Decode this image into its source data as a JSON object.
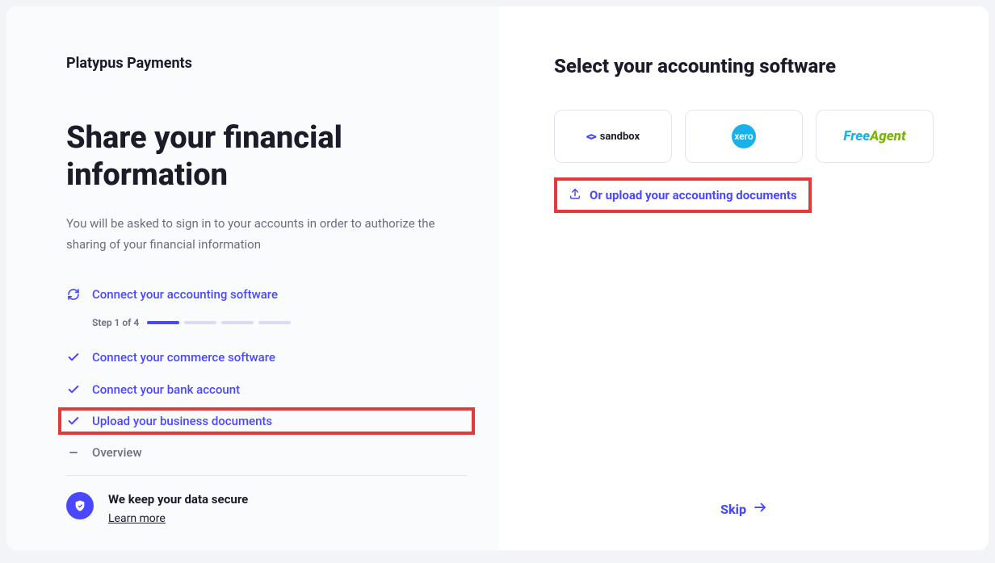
{
  "brand": "Platypus Payments",
  "heading": "Share your financial information",
  "subtext": "You will be asked to sign in to your accounts in order to authorize the sharing of your financial information",
  "steps": {
    "s1": "Connect your accounting software",
    "s2": "Connect your commerce software",
    "s3": "Connect your bank account",
    "s4": "Upload your business documents",
    "s5": "Overview"
  },
  "progress": {
    "label": "Step 1 of 4",
    "current": 1,
    "total": 4
  },
  "secure": {
    "title": "We keep your data secure",
    "learn": "Learn more"
  },
  "right": {
    "heading": "Select your accounting software",
    "upload": "Or upload your accounting documents",
    "skip": "Skip"
  },
  "software": {
    "sandbox": "sandbox",
    "xero": "xero",
    "freeagent_free": "Free",
    "freeagent_agent": "Agent"
  }
}
